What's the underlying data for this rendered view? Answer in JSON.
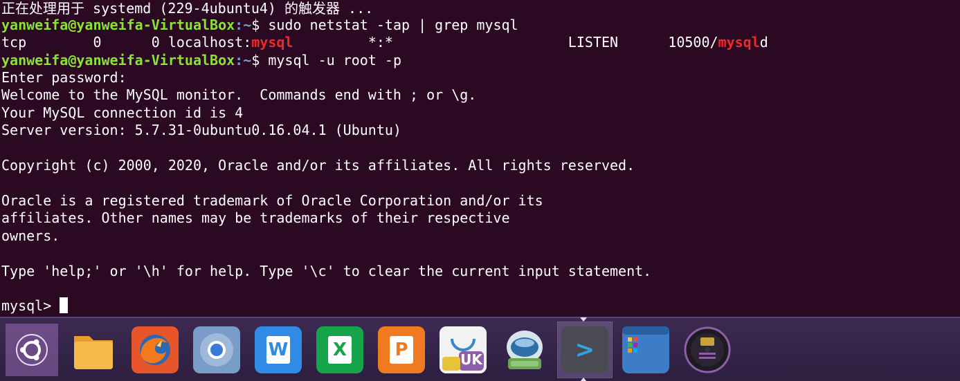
{
  "terminal": {
    "line0": "正在处理用于 systemd (229-4ubuntu4) 的触发器 ...",
    "line1": {
      "user": "yanweifa@yanweifa-VirtualBox",
      "path": ":~",
      "cmd": "$ sudo netstat -tap | grep mysql"
    },
    "line2": {
      "a": "tcp        0      0 localhost:",
      "hl1": "mysql",
      "b": "         *:*                     LISTEN      10500/",
      "hl2": "mysql",
      "c": "d"
    },
    "line3": {
      "user": "yanweifa@yanweifa-VirtualBox",
      "path": ":~",
      "cmd": "$ mysql -u root -p"
    },
    "line4": "Enter password:",
    "line5": "Welcome to the MySQL monitor.  Commands end with ; or \\g.",
    "line6": "Your MySQL connection id is 4",
    "line7": "Server version: 5.7.31-0ubuntu0.16.04.1 (Ubuntu)",
    "line9": "Copyright (c) 2000, 2020, Oracle and/or its affiliates. All rights reserved.",
    "line11": "Oracle is a registered trademark of Oracle Corporation and/or its",
    "line12": "affiliates. Other names may be trademarks of their respective",
    "line13": "owners.",
    "line15": "Type 'help;' or '\\h' for help. Type '\\c' to clear the current input statement.",
    "line17": "mysql> "
  },
  "dock": {
    "word_glyph": "W",
    "excel_glyph": "X",
    "ppt_glyph": "P",
    "uk_label": "UK",
    "terminal_glyph": ">"
  },
  "colors": {
    "terminal_bg": "#2c0922",
    "prompt_user": "#8ae234",
    "prompt_path": "#729fcf",
    "highlight": "#ef2929"
  }
}
